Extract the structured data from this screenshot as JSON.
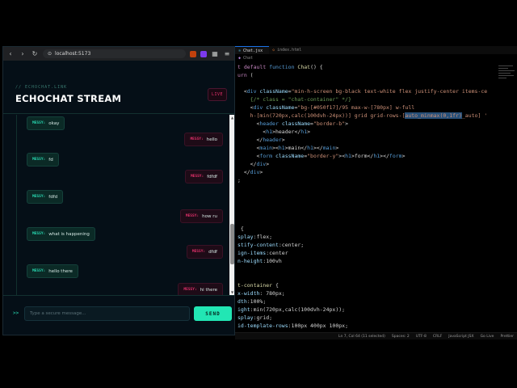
{
  "browser": {
    "url": "localhost:5173"
  },
  "app": {
    "subtitle": "// ECHOCHAT.LINK",
    "title": "ECHOCHAT STREAM",
    "live_label": "LIVE",
    "messages": [
      {
        "dir": "in",
        "tag": "MESSY:",
        "text": "okay"
      },
      {
        "dir": "out",
        "tag": "MESSY:",
        "text": "hello"
      },
      {
        "dir": "in",
        "tag": "MESSY:",
        "text": "fd"
      },
      {
        "dir": "out",
        "tag": "MESSY:",
        "text": "fdfdf"
      },
      {
        "dir": "in",
        "tag": "MESSY:",
        "text": "fdfd"
      },
      {
        "dir": "out",
        "tag": "MESSY:",
        "text": "how ru"
      },
      {
        "dir": "in",
        "tag": "MESSY:",
        "text": "what is happening"
      },
      {
        "dir": "out",
        "tag": "MESSY:",
        "text": "dfdf"
      },
      {
        "dir": "in",
        "tag": "MESSY:",
        "text": "hello there"
      },
      {
        "dir": "out",
        "tag": "MESSY:",
        "text": "hi there"
      }
    ],
    "prompt_symbol": ">>",
    "input_placeholder": "Type a secure message...",
    "send_label": "SEND"
  },
  "editor": {
    "tabs": [
      {
        "label": "Chat.jsx",
        "active": true
      },
      {
        "label": "index.html",
        "active": false
      }
    ],
    "breadcrumb": "Chat",
    "status": {
      "position": "Ln 7, Col 64 (11 selected)",
      "spaces": "Spaces: 2",
      "encoding": "UTF-8",
      "eol": "CRLF",
      "language": "JavaScript JSX",
      "golive": "Go Live",
      "prettier": "Prettier"
    }
  }
}
